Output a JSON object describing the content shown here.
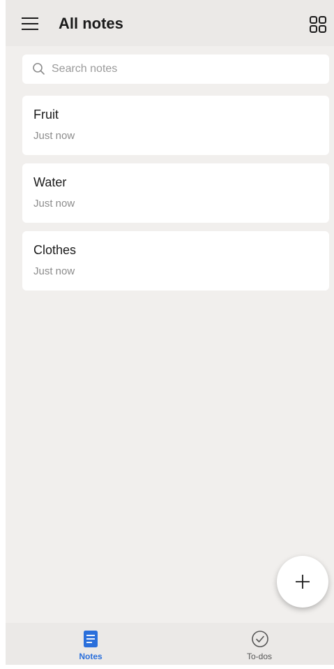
{
  "header": {
    "title": "All notes",
    "menu_icon": "hamburger-menu-icon",
    "grid_icon": "grid-view-icon"
  },
  "search": {
    "placeholder": "Search notes",
    "value": "",
    "icon": "search-icon"
  },
  "notes": [
    {
      "title": "Fruit",
      "time": "Just now"
    },
    {
      "title": "Water",
      "time": "Just now"
    },
    {
      "title": "Clothes",
      "time": "Just now"
    }
  ],
  "fab": {
    "icon": "plus-icon"
  },
  "bottom_nav": {
    "items": [
      {
        "label": "Notes",
        "icon": "note-document-icon",
        "active": true
      },
      {
        "label": "To-dos",
        "icon": "check-circle-icon",
        "active": false
      }
    ]
  },
  "colors": {
    "accent": "#2a6fdb",
    "background": "#f1efed",
    "header_background": "#ebe9e7",
    "card_background": "#ffffff"
  }
}
